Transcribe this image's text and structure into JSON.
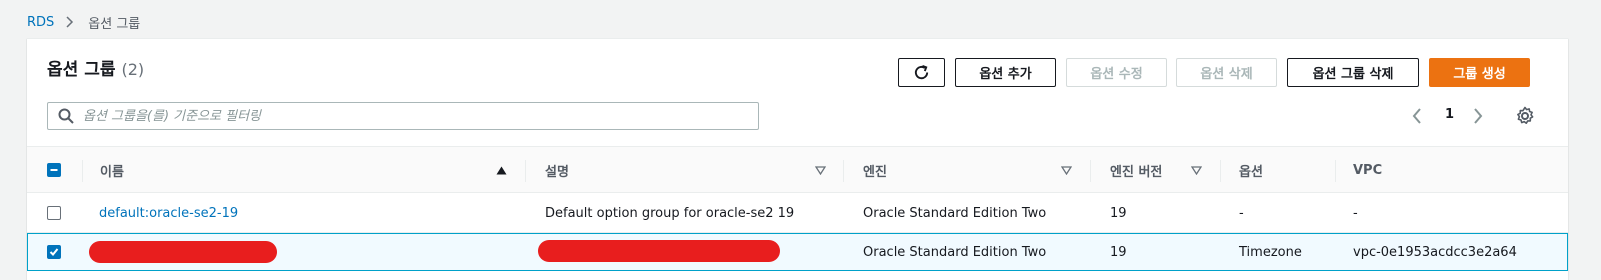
{
  "breadcrumb": {
    "root": "RDS",
    "current": "옵션 그룹"
  },
  "header": {
    "title": "옵션 그룹",
    "count": "(2)"
  },
  "toolbar": {
    "refresh_icon": "refresh-icon",
    "add_option": "옵션 추가",
    "modify_option": "옵션 수정",
    "delete_option": "옵션 삭제",
    "delete_group": "옵션 그룹 삭제",
    "create_group": "그룹 생성"
  },
  "search": {
    "placeholder": "옵션 그룹을(를) 기준으로 필터링",
    "value": ""
  },
  "pagination": {
    "page": "1"
  },
  "table": {
    "columns": [
      "이름",
      "설명",
      "엔진",
      "엔진 버전",
      "옵션",
      "VPC"
    ],
    "sorted_column": "이름",
    "rows": [
      {
        "selected": false,
        "name": "default:oracle-se2-19",
        "description": "Default option group for oracle-se2 19",
        "engine": "Oracle Standard Edition Two",
        "engine_version": "19",
        "options": "-",
        "vpc": "-"
      },
      {
        "selected": true,
        "name": "",
        "description": "",
        "engine": "Oracle Standard Edition Two",
        "engine_version": "19",
        "options": "Timezone",
        "vpc": "vpc-0e1953acdcc3e2a64"
      }
    ]
  },
  "colors": {
    "link": "#0073bb",
    "primary": "#ec7211",
    "selected_bg": "#f1faff",
    "redaction": "#e81e1e"
  }
}
